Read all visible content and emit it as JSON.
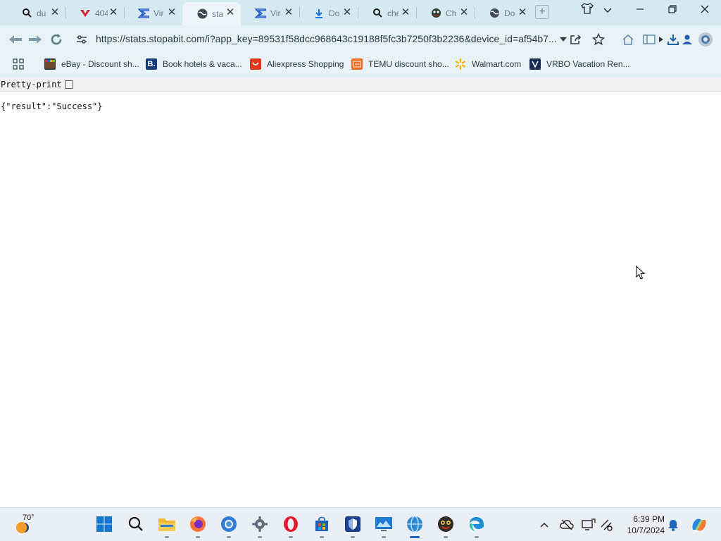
{
  "browser": {
    "tabs": [
      {
        "icon": "search-icon",
        "title": "du"
      },
      {
        "icon": "vivaldi-icon",
        "title": "404"
      },
      {
        "icon": "sigma-icon",
        "title": "Vir"
      },
      {
        "icon": "globe-icon",
        "title": "sta",
        "active": true
      },
      {
        "icon": "sigma-icon",
        "title": "Vir"
      },
      {
        "icon": "download-icon",
        "title": "Do"
      },
      {
        "icon": "search-icon",
        "title": "che"
      },
      {
        "icon": "chatbot-icon",
        "title": "Ch"
      },
      {
        "icon": "globe-icon",
        "title": "Do"
      }
    ],
    "close_glyph": "✕",
    "new_tab_glyph": "+",
    "url": "https://stats.stopabit.com/i?app_key=89531f58dcc968643c19188f5fc3b7250f3b2236&device_id=af54b7..."
  },
  "bookmarks": [
    {
      "icon": "ebay-icon",
      "label": "eBay - Discount sh...",
      "color": "#3a3a3a"
    },
    {
      "icon": "booking-icon",
      "label": "Book hotels & vaca...",
      "color": "#153a7a",
      "glyph": "B."
    },
    {
      "icon": "aliexpress-icon",
      "label": "Aliexpress Shopping",
      "color": "#e0381c"
    },
    {
      "icon": "temu-icon",
      "label": "TEMU discount sho...",
      "color": "#f26a1b"
    },
    {
      "icon": "walmart-icon",
      "label": "Walmart.com",
      "color": "#f5b400"
    },
    {
      "icon": "vrbo-icon",
      "label": "VRBO Vacation Ren...",
      "color": "#1b2a55"
    }
  ],
  "page": {
    "pretty_print_label": "Pretty-print",
    "json_text": "{\"result\":\"Success\"}"
  },
  "taskbar": {
    "weather_temp": "70°",
    "time": "6:39 PM",
    "date": "10/7/2024"
  }
}
